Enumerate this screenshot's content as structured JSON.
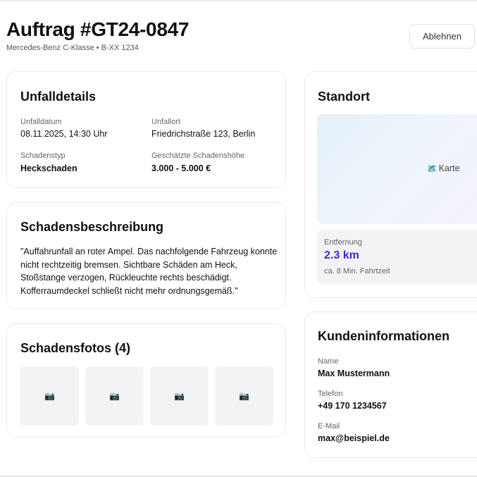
{
  "header": {
    "title": "Auftrag #GT24-0847",
    "subtitle": "Mercedes-Benz C-Klasse • B-XX 1234",
    "reject_label": "Ablehnen"
  },
  "accident": {
    "title": "Unfalldetails",
    "date_label": "Unfalldatum",
    "date_value": "08.11.2025, 14:30 Uhr",
    "place_label": "Unfallort",
    "place_value": "Friedrichstraße 123, Berlin",
    "type_label": "Schadenstyp",
    "type_value": "Heckschaden",
    "amount_label": "Geschätzte Schadenshöhe",
    "amount_value": "3.000 - 5.000 €"
  },
  "description": {
    "title": "Schadensbeschreibung",
    "text": "\"Auffahrunfall an roter Ampel. Das nachfolgende Fahrzeug konnte nicht rechtzeitig bremsen. Sichtbare Schäden am Heck, Stoßstange verzogen, Rückleuchte rechts beschädigt. Kofferraumdeckel schließt nicht mehr ordnungsgemäß.\""
  },
  "photos": {
    "title": "Schadensfotos (4)",
    "icon": "camera-icon",
    "items": [
      "📷",
      "📷",
      "📷",
      "📷"
    ]
  },
  "location": {
    "title": "Standort",
    "map_label": "Karte",
    "map_icon": "map-icon",
    "map_glyph": "🗺️",
    "distance_label": "Entfernung",
    "distance_value": "2.3 km",
    "travel_time": "ca. 8 Min. Fahrtzeit"
  },
  "customer": {
    "title": "Kundeninformationen",
    "name_label": "Name",
    "name_value": "Max Mustermann",
    "phone_label": "Telefon",
    "phone_value": "+49 170 1234567",
    "email_label": "E-Mail",
    "email_value": "max@beispiel.de"
  },
  "colors": {
    "accent": "#3b28d8",
    "card_border": "#ebebee",
    "muted_bg": "#f3f3f5"
  }
}
